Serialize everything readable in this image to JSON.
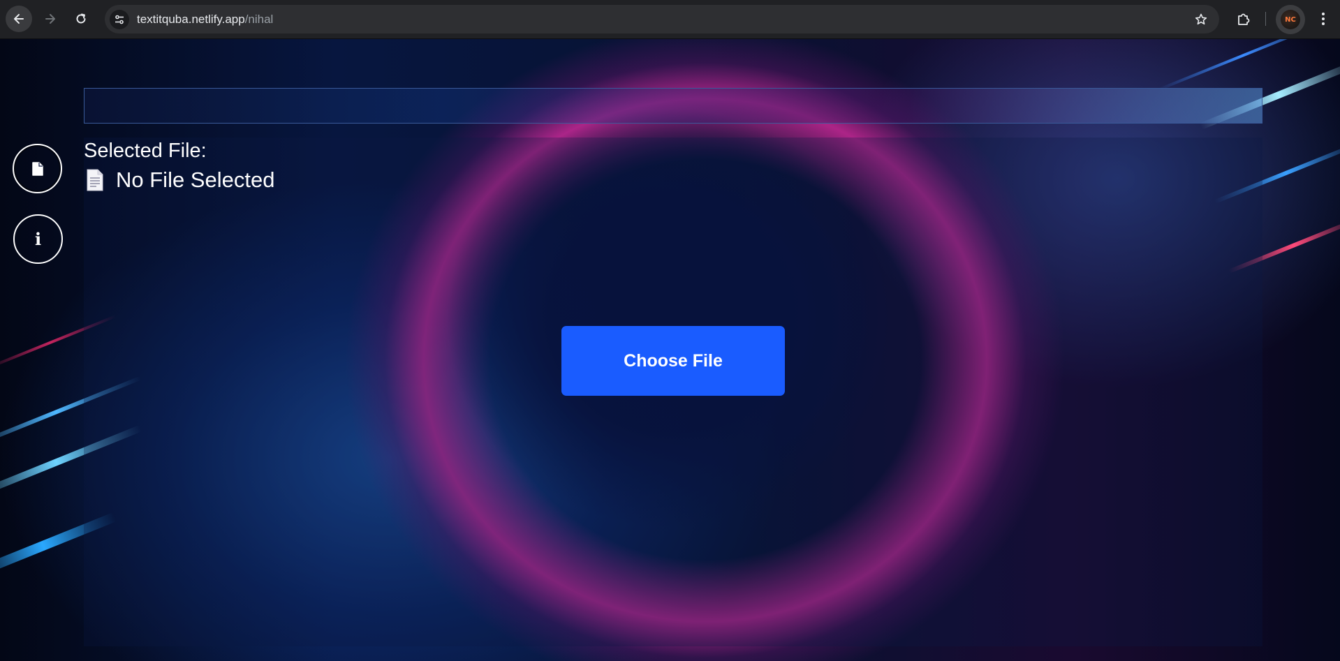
{
  "browser": {
    "url_domain": "textitquba.netlify.app",
    "url_path": "/nihal",
    "profile_initials": "NC"
  },
  "app": {
    "selected_label": "Selected File:",
    "file_name": "No File Selected",
    "choose_button_label": "Choose File",
    "info_glyph": "i"
  },
  "colors": {
    "accent": "#1a5cff",
    "chrome_bg": "#202124"
  },
  "icons": {
    "back": "arrow-left-icon",
    "forward": "arrow-right-icon",
    "reload": "reload-icon",
    "site_info": "tune-icon",
    "bookmark": "star-icon",
    "extensions": "puzzle-icon",
    "menu": "kebab-menu-icon",
    "file_nav": "file-icon",
    "info_nav": "info-icon",
    "document": "document-icon"
  }
}
